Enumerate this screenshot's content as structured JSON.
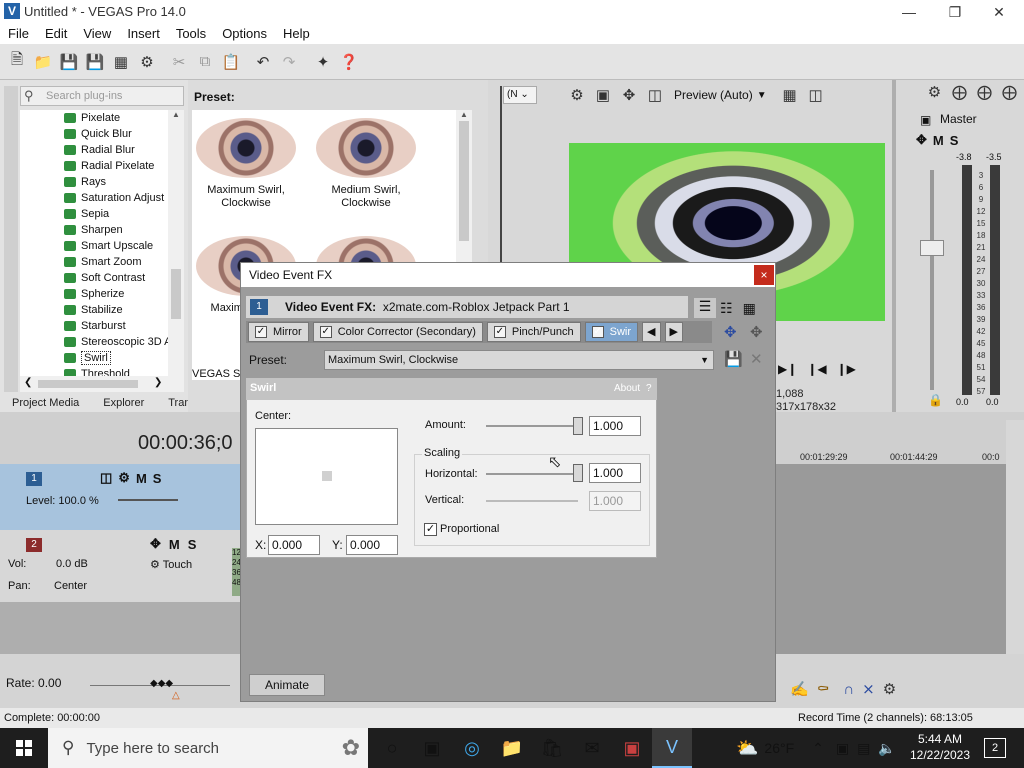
{
  "app": {
    "title": "Untitled * - VEGAS Pro 14.0",
    "logo": "V"
  },
  "menu": [
    "File",
    "Edit",
    "View",
    "Insert",
    "Tools",
    "Options",
    "Help"
  ],
  "plugins": {
    "search_placeholder": "Search plug-ins",
    "items": [
      "Pixelate",
      "Quick Blur",
      "Radial Blur",
      "Radial Pixelate",
      "Rays",
      "Saturation Adjust",
      "Sepia",
      "Sharpen",
      "Smart Upscale",
      "Smart Zoom",
      "Soft Contrast",
      "Spherize",
      "Stabilize",
      "Starburst",
      "Stereoscopic 3D A",
      "Swirl",
      "Threshold"
    ],
    "selected": "Swirl"
  },
  "presets": {
    "label": "Preset:",
    "thumbs": [
      {
        "label": "Maximum Swirl, Clockwise"
      },
      {
        "label": "Medium Swirl, Clockwise"
      },
      {
        "label": "Maxim Counte"
      },
      {
        "label": ""
      }
    ],
    "status": "VEGAS Sw"
  },
  "bottom_tabs": [
    "Project Media",
    "Explorer",
    "Transit"
  ],
  "preview": {
    "mode": "Preview (Auto)",
    "combo": "(N",
    "info_line1": "1,088",
    "info_line2": "317x178x32"
  },
  "master": {
    "label": "Master",
    "db_left": "-3.8",
    "db_right": "-3.5",
    "scale": [
      "3",
      "6",
      "9",
      "12",
      "15",
      "18",
      "21",
      "24",
      "27",
      "30",
      "33",
      "36",
      "39",
      "42",
      "45",
      "48",
      "51",
      "54",
      "57"
    ],
    "val_left": "0.0",
    "val_right": "0.0"
  },
  "timeline": {
    "timecode": "00:00:36;0",
    "ruler": [
      "00:01:29:29",
      "00:01:44:29",
      "00:0"
    ],
    "track1": {
      "number": "1",
      "level": "Level: 100.0 %"
    },
    "track2": {
      "number": "2",
      "vol_label": "Vol:",
      "vol_value": "0.0 dB",
      "pan_label": "Pan:",
      "pan_value": "Center",
      "touch": "Touch"
    },
    "clip_numbers": [
      "12",
      "24",
      "36",
      "48"
    ]
  },
  "rate": "Rate: 0.00",
  "status": {
    "left": "Complete: 00:00:00",
    "right": "Record Time (2 channels): 68:13:05"
  },
  "fx_dialog": {
    "title": "Video Event FX",
    "close": "×",
    "header_badge": "1",
    "header_label": "Video Event FX:",
    "header_value": "x2mate.com-Roblox Jetpack Part 1",
    "chain": [
      "Mirror",
      "Color Corrector (Secondary)",
      "Pinch/Punch",
      "Swir"
    ],
    "preset_label": "Preset:",
    "preset_value": "Maximum Swirl, Clockwise",
    "swirl": {
      "title": "Swirl",
      "about": "About",
      "help": "?",
      "center_label": "Center:",
      "x_label": "X:",
      "x_value": "0.000",
      "y_label": "Y:",
      "y_value": "0.000",
      "amount_label": "Amount:",
      "amount_value": "1.000",
      "scaling_label": "Scaling",
      "horizontal_label": "Horizontal:",
      "horizontal_value": "1.000",
      "vertical_label": "Vertical:",
      "vertical_value": "1.000",
      "proportional_label": "Proportional",
      "proportional_checked": true
    },
    "animate": "Animate"
  },
  "taskbar": {
    "search_placeholder": "Type here to search",
    "weather": "26°F",
    "time": "5:44 AM",
    "date": "12/22/2023",
    "notifications": "2"
  }
}
